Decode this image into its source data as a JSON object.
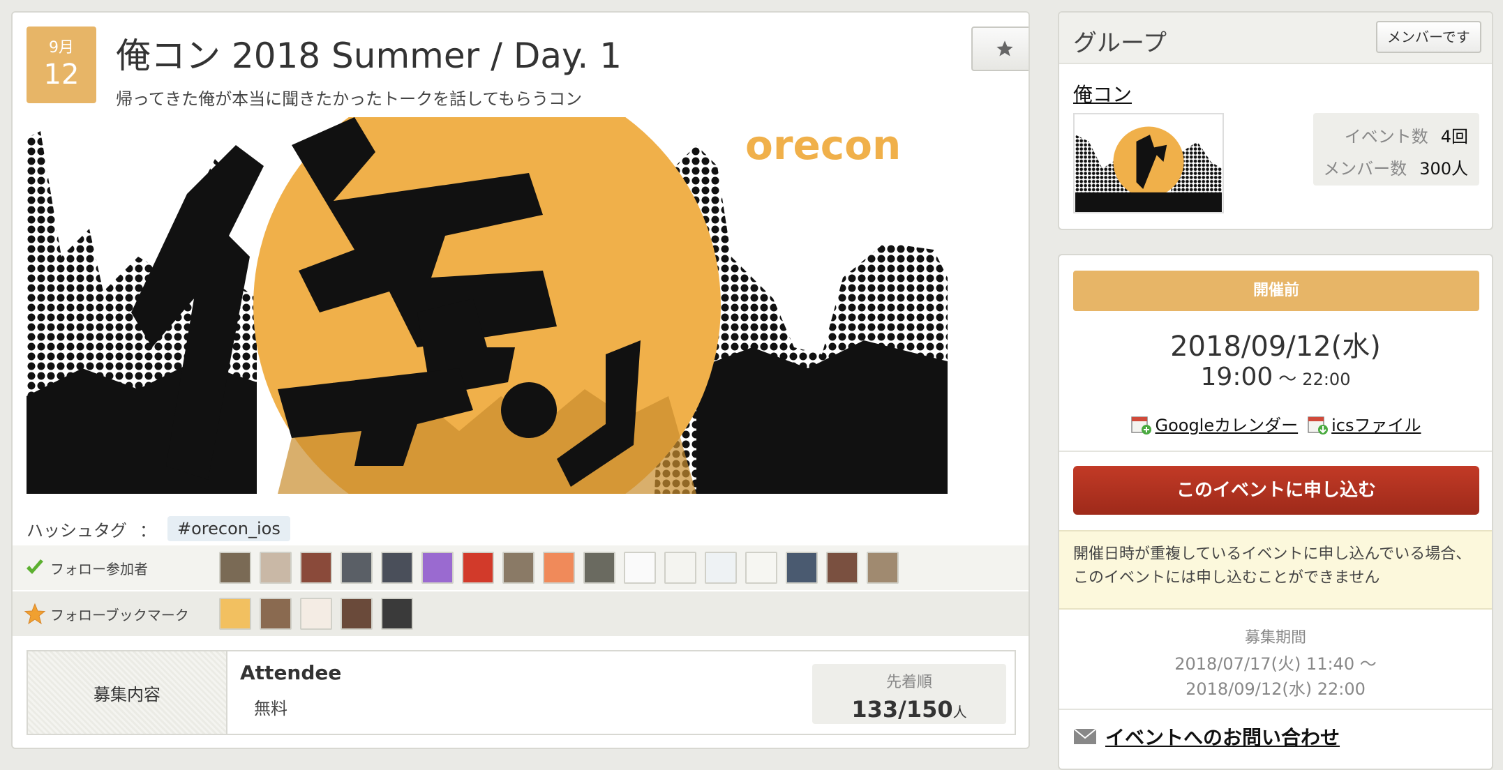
{
  "event": {
    "month": "9月",
    "day": "12",
    "title": "俺コン 2018 Summer / Day. 1",
    "subtitle": "帰ってきた俺が本当に聞きたかったトークを話してもらうコン",
    "banner_text": "orecon",
    "banner_kanji": "俺コン",
    "hashtag_label": "ハッシュタグ",
    "hashtag_sep": "：",
    "hashtag": "#orecon_ios"
  },
  "follow": {
    "attendees_label": "フォロー参加者",
    "bookmarks_label": "フォローブックマーク",
    "attendee_colors": [
      "#7a6a55",
      "#c9b8a6",
      "#8a4a3a",
      "#5a5f66",
      "#4a4f5a",
      "#9a6ad0",
      "#d23a2a",
      "#8a7a66",
      "#f08a5a",
      "#6a6a60",
      "#fafafa",
      "#f4f4f0",
      "#eef2f4",
      "#f6f6f2",
      "#4a5a70",
      "#7a5040",
      "#a08a70"
    ],
    "bookmark_colors": [
      "#f2c060",
      "#8a6a50",
      "#f4ece4",
      "#6a4a3a",
      "#3a3a3a"
    ]
  },
  "recruit": {
    "label": "募集内容",
    "ticket_name": "Attendee",
    "price": "無料",
    "order_label": "先着順",
    "count": "133/150",
    "unit": "人"
  },
  "group": {
    "header": "グループ",
    "member_button": "メンバーです",
    "name": "俺コン",
    "events_label": "イベント数",
    "events_value": "4回",
    "members_label": "メンバー数",
    "members_value": "300人"
  },
  "schedule": {
    "status": "開催前",
    "date": "2018/09/12(水)",
    "start": "19:00",
    "tilde": "〜",
    "end": "22:00",
    "google_cal": "Googleカレンダー",
    "ics": "icsファイル",
    "apply_button": "このイベントに申し込む",
    "notice": "開催日時が重複しているイベントに申し込んでいる場合、このイベントには申し込むことができません",
    "period_label": "募集期間",
    "period_start": "2018/07/17(火) 11:40 〜",
    "period_end": "2018/09/12(水) 22:00",
    "contact": "イベントへのお問い合わせ"
  },
  "colors": {
    "accent": "#e7b567",
    "apply": "#b23220",
    "banner_orange": "#f0b04a"
  }
}
